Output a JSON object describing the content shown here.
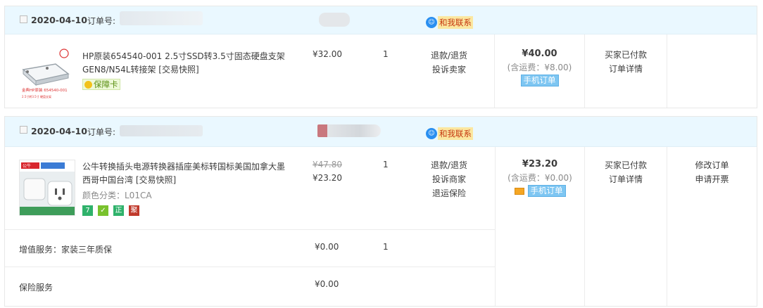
{
  "orders": [
    {
      "date": "2020-04-10",
      "order_no_label": "订单号:",
      "contact_label": "和我联系",
      "product_title": "HP原装654540-001 2.5寸SSD转3.5寸固态硬盘支架GEN8/N54L转接架 [交易快照]",
      "guarantee_label": "保障卡",
      "thumb_text": "金典HP原装",
      "price": "¥32.00",
      "quantity": "1",
      "actions": [
        "退款/退货",
        "投诉卖家"
      ],
      "total": "¥40.00",
      "shipping": "(含运费：¥8.00)",
      "mobile_label": "手机订单",
      "status": "买家已付款",
      "detail_link": "订单详情"
    },
    {
      "date": "2020-04-10",
      "order_no_label": "订单号:",
      "contact_label": "和我联系",
      "product_title": "公牛转换插头电源转换器插座美标转国标美国加拿大墨西哥中国台湾 [交易快照]",
      "color_class": "颜色分类：L01CA",
      "thumb_text": "公牛",
      "original_price": "¥47.80",
      "price": "¥23.20",
      "quantity": "1",
      "actions": [
        "退款/退货",
        "投诉商家",
        "退运保险"
      ],
      "total": "¥23.20",
      "shipping": "(含运费：¥0.00)",
      "mobile_label": "手机订单",
      "status": "买家已付款",
      "detail_link": "订单详情",
      "ops": [
        "修改订单",
        "申请开票"
      ],
      "badges": [
        "7",
        "✓",
        "正",
        "聚"
      ],
      "badge_colors": [
        "#2fb26b",
        "#79c22d",
        "#2fb26b",
        "#c0392b"
      ],
      "services": [
        {
          "name": "增值服务：家装三年质保",
          "price": "¥0.00",
          "qty": "1"
        },
        {
          "name": "保险服务",
          "price": "¥0.00"
        }
      ]
    }
  ]
}
